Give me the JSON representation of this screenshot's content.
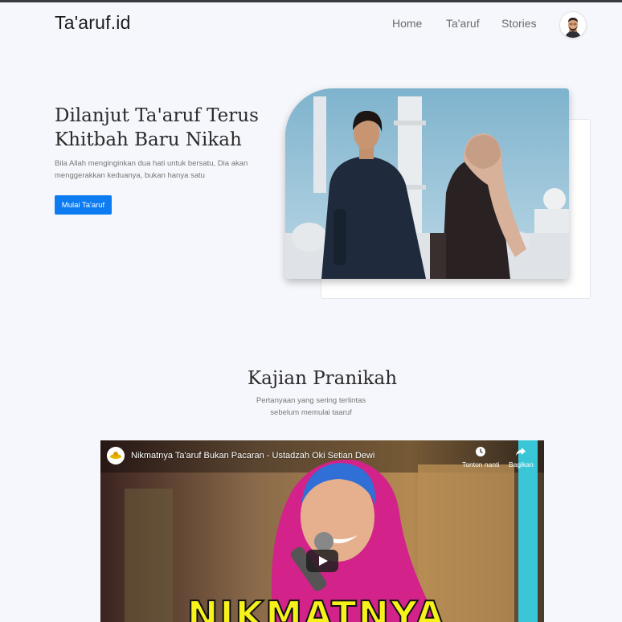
{
  "brand": "Ta'aruf.id",
  "nav": {
    "items": [
      "Home",
      "Ta'aruf",
      "Stories"
    ]
  },
  "hero": {
    "title_line1": "Dilanjut Ta'aruf Terus",
    "title_line2": "Khitbah Baru Nikah",
    "subtitle_line1": "Bila Allah menginginkan dua hati untuk bersatu, Dia akan",
    "subtitle_line2": "menggerakkan keduanya, bukan hanya satu",
    "cta_label": "Mulai Ta'aruf"
  },
  "section": {
    "title": "Kajian Pranikah",
    "subtitle_line1": "Pertanyaan yang sering terlintas",
    "subtitle_line2": "sebelum memulai taaruf"
  },
  "video": {
    "title": "Nikmatnya Ta'aruf Bukan Pacaran - Ustadzah Oki Setian Dewi",
    "watch_later_label": "Tonton nanti",
    "share_label": "Bagikan",
    "caption": "NIKMATNYA"
  },
  "colors": {
    "accent": "#0d7bf1",
    "background": "#f6f7fc",
    "caption": "#f7f21c"
  },
  "icons": [
    "avatar-icon",
    "clock-icon",
    "share-icon",
    "play-icon",
    "channel-logo"
  ]
}
